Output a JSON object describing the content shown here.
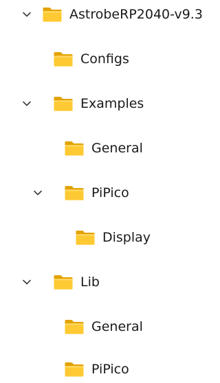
{
  "tree": {
    "items": [
      {
        "label": "AstrobeRP2040-v9.3",
        "expanded": true,
        "icon": "folder-icon"
      },
      {
        "label": "Configs",
        "expanded": false,
        "icon": "folder-icon"
      },
      {
        "label": "Examples",
        "expanded": true,
        "icon": "folder-icon"
      },
      {
        "label": "General",
        "expanded": false,
        "icon": "folder-icon"
      },
      {
        "label": "PiPico",
        "expanded": true,
        "icon": "folder-icon"
      },
      {
        "label": "Display",
        "expanded": false,
        "icon": "folder-icon"
      },
      {
        "label": "Lib",
        "expanded": true,
        "icon": "folder-icon"
      },
      {
        "label": "General",
        "expanded": false,
        "icon": "folder-icon"
      },
      {
        "label": "PiPico",
        "expanded": false,
        "icon": "folder-icon"
      }
    ]
  },
  "colors": {
    "folder_back": "#e8a900",
    "folder_front": "#ffca28",
    "folder_tab": "#f0b400",
    "chevron": "#3a3a3a",
    "text": "#1a1a1a"
  }
}
